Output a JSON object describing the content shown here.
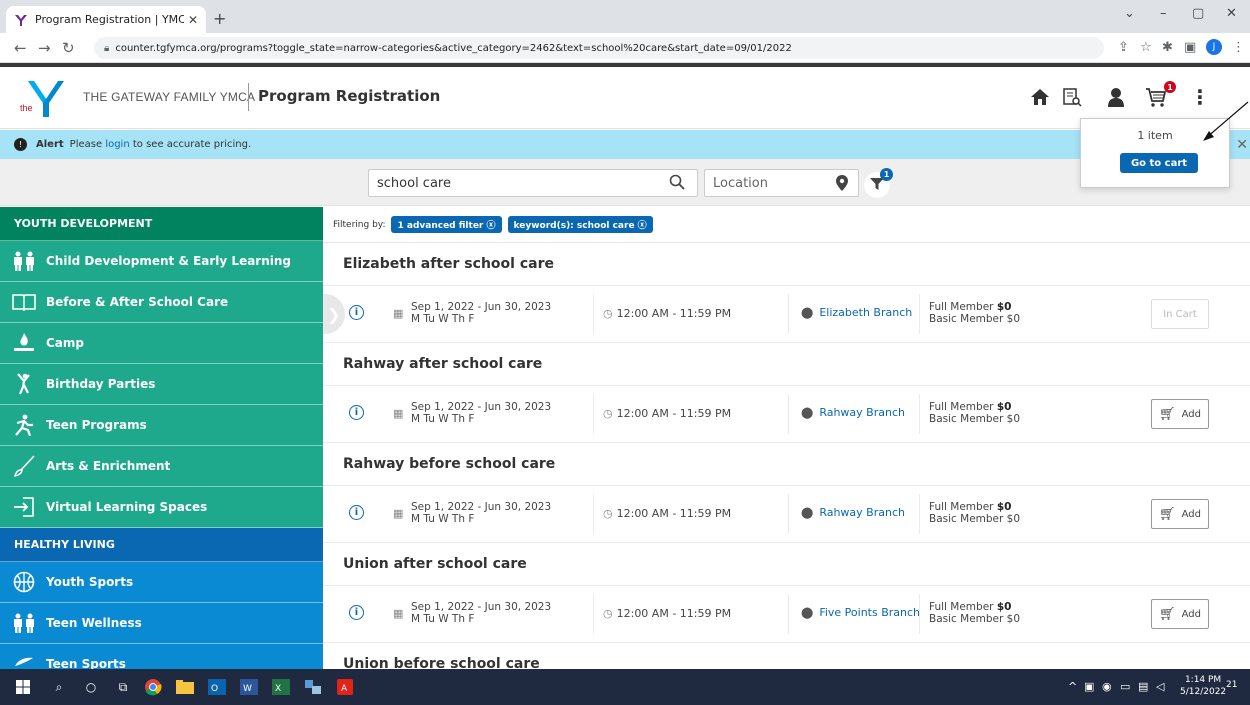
{
  "browser": {
    "tab_title": "Program Registration | YMCA Co",
    "url": "counter.tgfymca.org/programs?toggle_state=narrow-categories&active_category=2462&text=school%20care&start_date=09/01/2022",
    "profile_initial": "J"
  },
  "header": {
    "org_name": "THE GATEWAY FAMILY YMCA",
    "app_title": "Program Registration",
    "logo_text": "the",
    "cart_count": "1"
  },
  "alert": {
    "label": "Alert",
    "prefix": "Please",
    "link": "login",
    "suffix": "to see accurate pricing."
  },
  "search": {
    "keyword": "school care",
    "location_placeholder": "Location",
    "filter_count": "1"
  },
  "cart_popover": {
    "count_text": "1 item",
    "button": "Go to cart"
  },
  "sidebar": {
    "sections": [
      {
        "heading": "YOUTH DEVELOPMENT",
        "items": [
          {
            "label": "Child Development & Early Learning",
            "icon": "children-icon"
          },
          {
            "label": "Before & After School Care",
            "icon": "book-icon"
          },
          {
            "label": "Camp",
            "icon": "campfire-icon"
          },
          {
            "label": "Birthday Parties",
            "icon": "dancer-icon"
          },
          {
            "label": "Teen Programs",
            "icon": "runner-icon"
          },
          {
            "label": "Arts & Enrichment",
            "icon": "paintbrush-icon"
          },
          {
            "label": "Virtual Learning Spaces",
            "icon": "enter-icon"
          }
        ]
      },
      {
        "heading": "HEALTHY LIVING",
        "items": [
          {
            "label": "Youth Sports",
            "icon": "basketball-icon"
          },
          {
            "label": "Teen Wellness",
            "icon": "children-icon"
          },
          {
            "label": "Teen Sports",
            "icon": "swim-icon"
          }
        ]
      }
    ]
  },
  "filters": {
    "label": "Filtering by:",
    "chips": [
      "1 advanced filter ⓧ",
      "keyword(s): school care ⓧ"
    ]
  },
  "programs": [
    {
      "title": "Elizabeth after school care",
      "dates": "Sep 1, 2022 - Jun 30, 2023",
      "days": "M Tu W Th F",
      "time": "12:00 AM - 11:59 PM",
      "branch": "Elizabeth Branch",
      "full_label": "Full Member",
      "full_price": "$0",
      "basic": "Basic Member $0",
      "action": "In Cart"
    },
    {
      "title": "Rahway after school care",
      "dates": "Sep 1, 2022 - Jun 30, 2023",
      "days": "M Tu W Th F",
      "time": "12:00 AM - 11:59 PM",
      "branch": "Rahway Branch",
      "full_label": "Full Member",
      "full_price": "$0",
      "basic": "Basic Member $0",
      "action": "Add"
    },
    {
      "title": "Rahway before school care",
      "dates": "Sep 1, 2022 - Jun 30, 2023",
      "days": "M Tu W Th F",
      "time": "12:00 AM - 11:59 PM",
      "branch": "Rahway Branch",
      "full_label": "Full Member",
      "full_price": "$0",
      "basic": "Basic Member $0",
      "action": "Add"
    },
    {
      "title": "Union after school care",
      "dates": "Sep 1, 2022 - Jun 30, 2023",
      "days": "M Tu W Th F",
      "time": "12:00 AM - 11:59 PM",
      "branch": "Five Points Branch",
      "full_label": "Full Member",
      "full_price": "$0",
      "basic": "Basic Member $0",
      "action": "Add"
    },
    {
      "title": "Union before school care"
    }
  ],
  "taskbar": {
    "time": "1:14 PM",
    "date": "5/12/2022",
    "notifications": "21"
  },
  "colors": {
    "youth_green": "#1ea98c",
    "youth_green_dark": "#00835e",
    "living_blue": "#0a8ad2",
    "living_blue_dark": "#0a67b1",
    "alert_bg": "#a6e3f7",
    "cart_badge": "#d0021b"
  }
}
